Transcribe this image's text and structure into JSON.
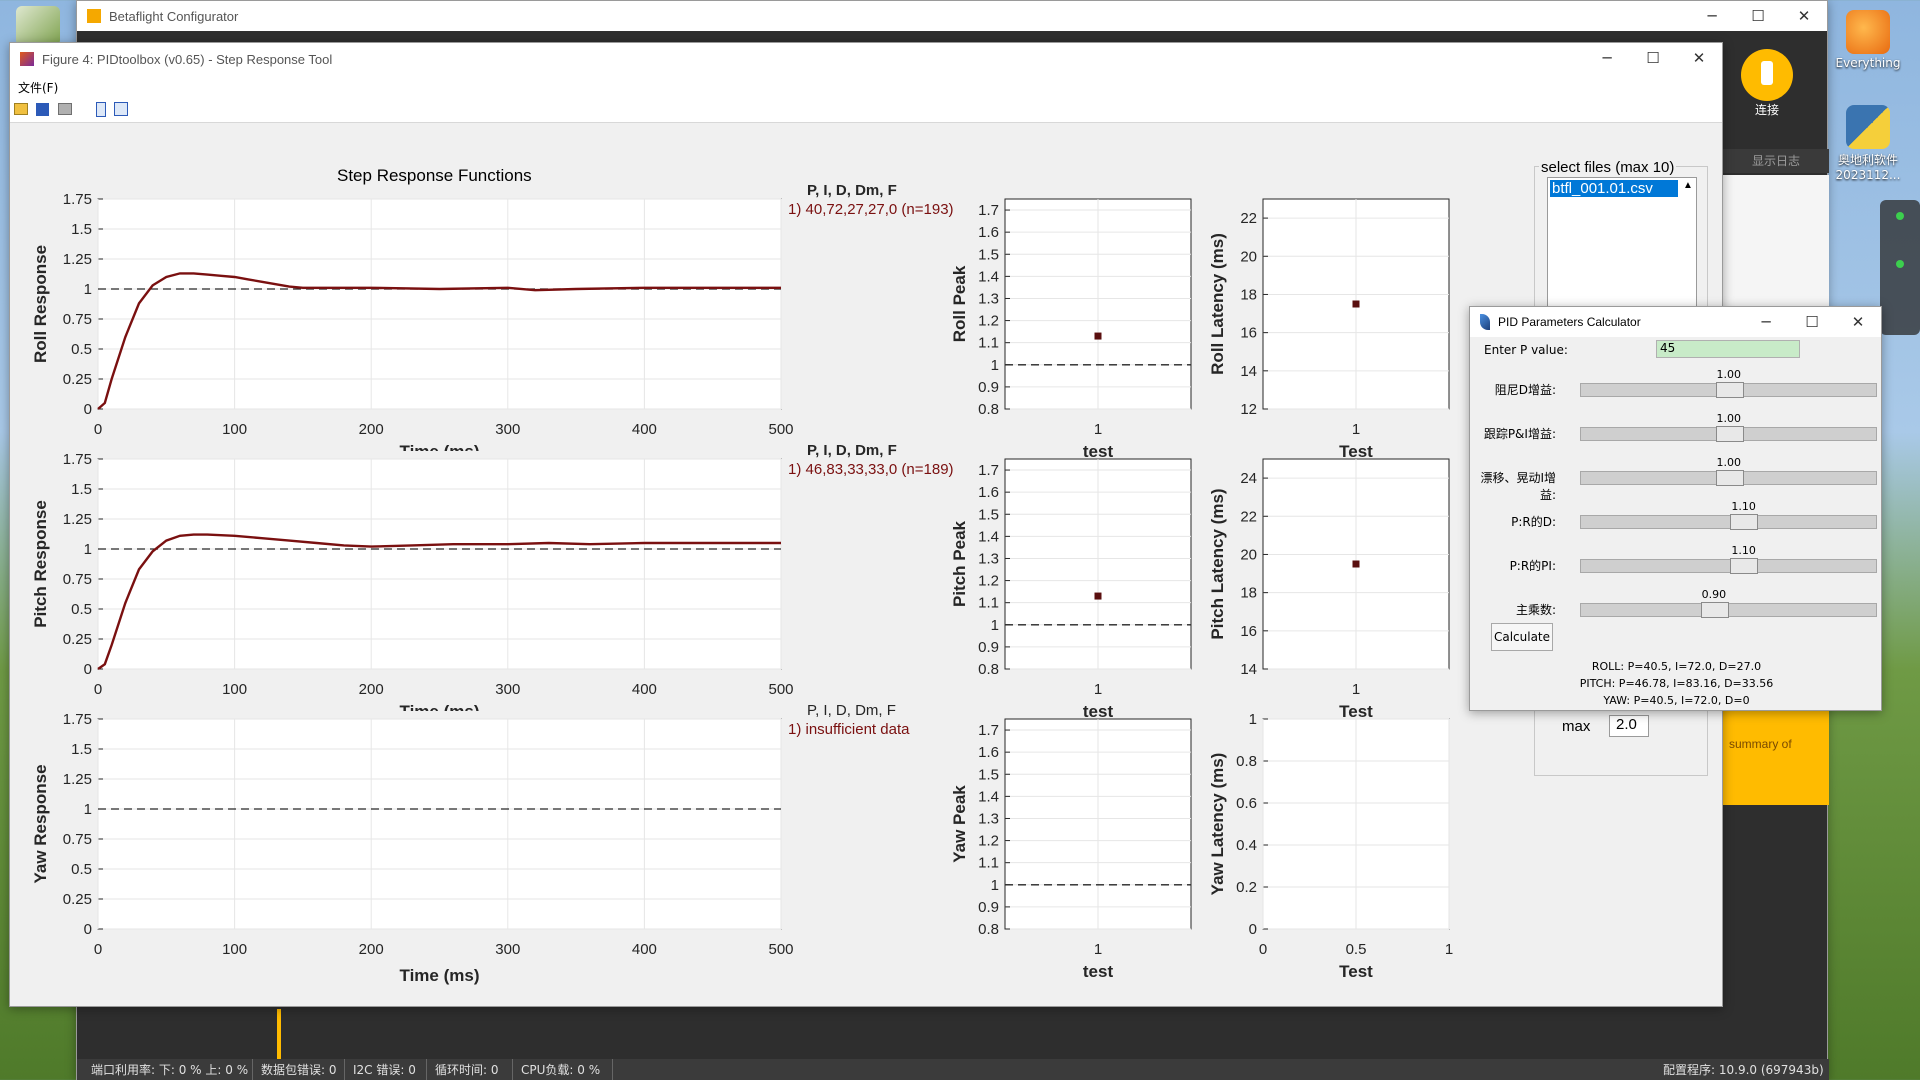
{
  "desktop": {
    "right_icons": [
      {
        "label": "Everything"
      },
      {
        "label": "奥地利软件\n2023112..."
      }
    ]
  },
  "betaflight": {
    "title": "Betaflight Configurator",
    "connect_label": "连接",
    "log_tab": "显示日志",
    "side_label": "summary of",
    "statusbar": [
      {
        "label": "端口利用率: 下: 0 % 上: 0 %"
      },
      {
        "label": "数据包错误: 0"
      },
      {
        "label": "I2C 错误: 0"
      },
      {
        "label": "循环时间: 0"
      },
      {
        "label": "CPU负载: 0 %"
      }
    ],
    "status_right": "配置程序: 10.9.0 (697943b)"
  },
  "figure": {
    "title": "Figure 4: PIDtoolbox (v0.65) - Step Response Tool",
    "menu_file": "文件(F)",
    "toolbar_icons": [
      "open-folder-icon",
      "save-icon",
      "print-icon",
      "panel-icon",
      "layout-icon"
    ],
    "main_title": "Step Response Functions",
    "x_label": "Time (ms)",
    "x_label_clipped": "Time (ms)",
    "legends": [
      {
        "header": "P, I, D, Dm, F",
        "value": "1) 40,72,27,27,0  (n=193)",
        "bold": true
      },
      {
        "header": "P, I, D, Dm, F",
        "value": "1) 46,83,33,33,0  (n=189)",
        "bold": true
      },
      {
        "header": "P, I, D, Dm, F",
        "value": "1) insufficient data",
        "bold": false
      }
    ],
    "file_list": {
      "title": "select files (max 10)",
      "selected": "btfl_001.01.csv"
    },
    "max_label": "max",
    "max_value": "2.0"
  },
  "calculator": {
    "title": "PID Parameters Calculator",
    "p_label": "Enter P value:",
    "p_value": "45",
    "sliders": [
      {
        "label": "阻尼D增益:",
        "value": "1.00",
        "fraction": 0.5
      },
      {
        "label": "跟踪P&I增益:",
        "value": "1.00",
        "fraction": 0.5
      },
      {
        "label": "漂移、晃动I增益:",
        "value": "1.00",
        "fraction": 0.5
      },
      {
        "label": "P:R的D:",
        "value": "1.10",
        "fraction": 0.55
      },
      {
        "label": "P:R的PI:",
        "value": "1.10",
        "fraction": 0.55
      },
      {
        "label": "主乘数:",
        "value": "0.90",
        "fraction": 0.45
      }
    ],
    "calculate_label": "Calculate",
    "results": [
      "ROLL: P=40.5, I=72.0, D=27.0",
      "PITCH: P=46.78, I=83.16, D=33.56",
      "YAW: P=40.5, I=72.0, D=0"
    ]
  },
  "chart_data": [
    {
      "type": "line",
      "title": "Step Response Functions",
      "xlabel": "Time (ms)",
      "ylabel": "Roll Response",
      "xlim": [
        0,
        500
      ],
      "ylim": [
        0,
        1.75
      ],
      "xticks": [
        0,
        100,
        200,
        300,
        400,
        500
      ],
      "yticks": [
        "0",
        "0.25",
        "0.5",
        "0.75",
        "1",
        "1.25",
        "1.5",
        "1.75"
      ],
      "reference_line": 1,
      "series": [
        {
          "color": "#7a1010",
          "x": [
            0,
            5,
            10,
            20,
            30,
            40,
            50,
            60,
            70,
            80,
            90,
            100,
            110,
            120,
            130,
            140,
            150,
            170,
            200,
            250,
            300,
            320,
            350,
            400,
            450,
            500
          ],
          "y": [
            0,
            0.05,
            0.25,
            0.6,
            0.88,
            1.03,
            1.1,
            1.13,
            1.13,
            1.12,
            1.11,
            1.1,
            1.08,
            1.06,
            1.04,
            1.02,
            1.01,
            1.01,
            1.01,
            1.0,
            1.01,
            0.99,
            1.0,
            1.01,
            1.01,
            1.01
          ]
        }
      ]
    },
    {
      "type": "line",
      "xlabel": "Time (ms)",
      "ylabel": "Pitch Response",
      "xlim": [
        0,
        500
      ],
      "ylim": [
        0,
        1.75
      ],
      "xticks": [
        0,
        100,
        200,
        300,
        400,
        500
      ],
      "yticks": [
        "0",
        "0.25",
        "0.5",
        "0.75",
        "1",
        "1.25",
        "1.5",
        "1.75"
      ],
      "reference_line": 1,
      "series": [
        {
          "color": "#7a1010",
          "x": [
            0,
            5,
            10,
            20,
            30,
            40,
            50,
            60,
            70,
            80,
            100,
            120,
            140,
            160,
            180,
            200,
            230,
            260,
            300,
            330,
            360,
            400,
            450,
            500
          ],
          "y": [
            0,
            0.04,
            0.2,
            0.55,
            0.83,
            0.98,
            1.07,
            1.11,
            1.12,
            1.12,
            1.11,
            1.09,
            1.07,
            1.05,
            1.03,
            1.02,
            1.03,
            1.04,
            1.04,
            1.05,
            1.04,
            1.05,
            1.05,
            1.05
          ]
        }
      ]
    },
    {
      "type": "line",
      "xlabel": "Time (ms)",
      "ylabel": "Yaw Response",
      "xlim": [
        0,
        500
      ],
      "ylim": [
        0,
        1.75
      ],
      "xticks": [
        0,
        100,
        200,
        300,
        400,
        500
      ],
      "yticks": [
        "0",
        "0.25",
        "0.5",
        "0.75",
        "1",
        "1.25",
        "1.5",
        "1.75"
      ],
      "reference_line": 1,
      "series": []
    },
    {
      "type": "scatter",
      "xlabel": "test",
      "ylabel": "Roll Peak",
      "ylim": [
        0.8,
        1.75
      ],
      "xticks": [
        "1"
      ],
      "yticks": [
        "0.8",
        "0.9",
        "1",
        "1.1",
        "1.2",
        "1.3",
        "1.4",
        "1.5",
        "1.6",
        "1.7"
      ],
      "reference_line": 1,
      "points": [
        {
          "x": 1,
          "y": 1.13
        }
      ]
    },
    {
      "type": "scatter",
      "xlabel": "Test",
      "ylabel": "Roll Latency (ms)",
      "ylim": [
        12,
        23
      ],
      "xticks": [
        "1"
      ],
      "yticks": [
        "12",
        "14",
        "16",
        "18",
        "20",
        "22"
      ],
      "points": [
        {
          "x": 1,
          "y": 17.5
        }
      ]
    },
    {
      "type": "scatter",
      "xlabel": "test",
      "ylabel": "Pitch Peak",
      "ylim": [
        0.8,
        1.75
      ],
      "xticks": [
        "1"
      ],
      "yticks": [
        "0.8",
        "0.9",
        "1",
        "1.1",
        "1.2",
        "1.3",
        "1.4",
        "1.5",
        "1.6",
        "1.7"
      ],
      "reference_line": 1,
      "points": [
        {
          "x": 1,
          "y": 1.13
        }
      ]
    },
    {
      "type": "scatter",
      "xlabel": "Test",
      "ylabel": "Pitch Latency (ms)",
      "ylim": [
        14,
        25
      ],
      "xticks": [
        "1"
      ],
      "yticks": [
        "14",
        "16",
        "18",
        "20",
        "22",
        "24"
      ],
      "points": [
        {
          "x": 1,
          "y": 19.5
        }
      ]
    },
    {
      "type": "scatter",
      "xlabel": "test",
      "ylabel": "Yaw Peak",
      "ylim": [
        0.8,
        1.75
      ],
      "xticks": [
        "1"
      ],
      "yticks": [
        "0.8",
        "0.9",
        "1",
        "1.1",
        "1.2",
        "1.3",
        "1.4",
        "1.5",
        "1.6",
        "1.7"
      ],
      "reference_line": 1,
      "points": []
    },
    {
      "type": "scatter",
      "xlabel": "Test",
      "ylabel": "Yaw Latency (ms)",
      "ylim": [
        0,
        1
      ],
      "xlim": [
        0,
        1
      ],
      "xticks": [
        "0",
        "0.5",
        "1"
      ],
      "yticks": [
        "0",
        "0.2",
        "0.4",
        "0.6",
        "0.8",
        "1"
      ],
      "points": []
    }
  ]
}
